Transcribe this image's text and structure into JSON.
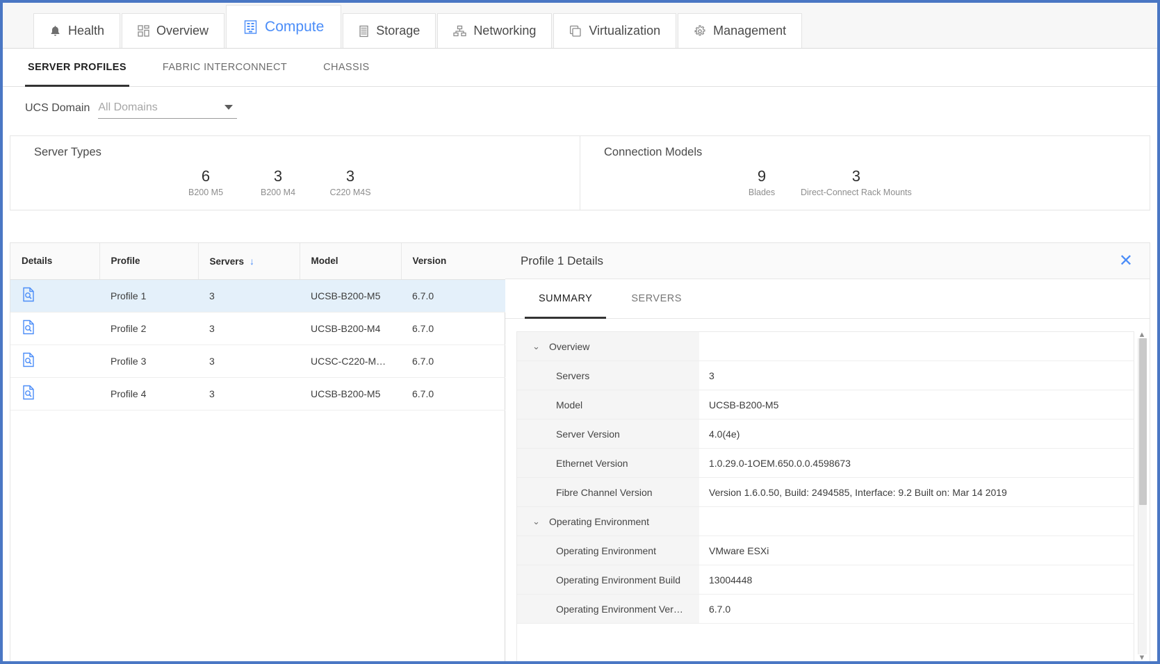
{
  "top_tabs": [
    {
      "label": "Health",
      "icon": "bell-icon",
      "active": false
    },
    {
      "label": "Overview",
      "icon": "grid-icon",
      "active": false
    },
    {
      "label": "Compute",
      "icon": "server-rack-icon",
      "active": true
    },
    {
      "label": "Storage",
      "icon": "storage-stack-icon",
      "active": false
    },
    {
      "label": "Networking",
      "icon": "network-tree-icon",
      "active": false
    },
    {
      "label": "Virtualization",
      "icon": "copy-windows-icon",
      "active": false
    },
    {
      "label": "Management",
      "icon": "gear-icon",
      "active": false
    }
  ],
  "sub_tabs": [
    {
      "label": "SERVER PROFILES",
      "active": true
    },
    {
      "label": "FABRIC INTERCONNECT",
      "active": false
    },
    {
      "label": "CHASSIS",
      "active": false
    }
  ],
  "filter": {
    "label": "UCS Domain",
    "value": "All Domains",
    "placeholder": "All Domains"
  },
  "cards": [
    {
      "title": "Server Types",
      "stats": [
        {
          "value": "6",
          "label": "B200 M5"
        },
        {
          "value": "3",
          "label": "B200 M4"
        },
        {
          "value": "3",
          "label": "C220 M4S"
        }
      ]
    },
    {
      "title": "Connection Models",
      "stats": [
        {
          "value": "9",
          "label": "Blades"
        },
        {
          "value": "3",
          "label": "Direct-Connect Rack Mounts"
        }
      ]
    }
  ],
  "table": {
    "columns": [
      {
        "label": "Details",
        "sorted": false
      },
      {
        "label": "Profile",
        "sorted": false
      },
      {
        "label": "Servers",
        "sorted": true,
        "sort_direction": "↓"
      },
      {
        "label": "Model",
        "sorted": false
      },
      {
        "label": "Version",
        "sorted": false
      }
    ],
    "rows": [
      {
        "details_icon": "document-search-icon",
        "profile": "Profile 1",
        "servers": "3",
        "model": "UCSB-B200-M5",
        "version": "6.7.0",
        "selected": true
      },
      {
        "details_icon": "document-search-icon",
        "profile": "Profile 2",
        "servers": "3",
        "model": "UCSB-B200-M4",
        "version": "6.7.0",
        "selected": false
      },
      {
        "details_icon": "document-search-icon",
        "profile": "Profile 3",
        "servers": "3",
        "model": "UCSC-C220-M…",
        "version": "6.7.0",
        "selected": false
      },
      {
        "details_icon": "document-search-icon",
        "profile": "Profile 4",
        "servers": "3",
        "model": "UCSB-B200-M5",
        "version": "6.7.0",
        "selected": false
      }
    ]
  },
  "detail_panel": {
    "title": "Profile 1 Details",
    "close_label": "✕",
    "tabs": [
      {
        "label": "SUMMARY",
        "active": true
      },
      {
        "label": "SERVERS",
        "active": false
      }
    ],
    "sections": [
      {
        "type": "group",
        "label": "Overview",
        "chevron": "⌄",
        "value": ""
      },
      {
        "type": "row",
        "label": "Servers",
        "value": "3"
      },
      {
        "type": "row",
        "label": "Model",
        "value": "UCSB-B200-M5"
      },
      {
        "type": "row",
        "label": "Server Version",
        "value": "4.0(4e)"
      },
      {
        "type": "row",
        "label": "Ethernet Version",
        "value": "1.0.29.0-1OEM.650.0.0.4598673"
      },
      {
        "type": "row",
        "label": "Fibre Channel Version",
        "value": "Version 1.6.0.50, Build: 2494585, Interface: 9.2 Built on: Mar 14 2019"
      },
      {
        "type": "group",
        "label": "Operating Environment",
        "chevron": "⌄",
        "value": ""
      },
      {
        "type": "row",
        "label": "Operating Environment",
        "value": "VMware ESXi"
      },
      {
        "type": "row",
        "label": "Operating Environment Build",
        "value": "13004448"
      },
      {
        "type": "row",
        "label": "Operating Environment Ver…",
        "value": "6.7.0"
      }
    ],
    "scrollbar": {
      "up": "▲",
      "down": "▼"
    }
  },
  "colors": {
    "accent": "#4b8df8",
    "window_border": "#4a77c4",
    "selected_row": "#e4f0fa"
  }
}
